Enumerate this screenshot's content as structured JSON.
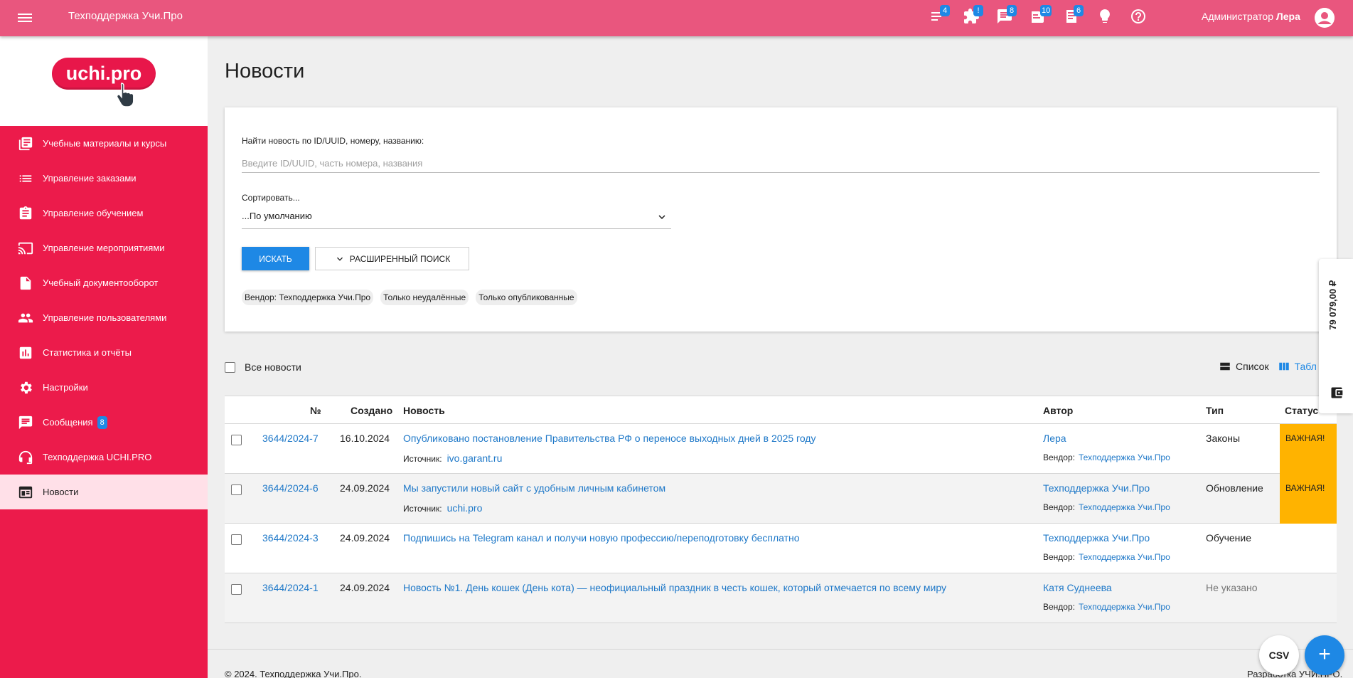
{
  "topbar": {
    "app_title": "Техподдержка Учи.Про",
    "icons": [
      {
        "name": "notifications-list-icon",
        "badge": "4"
      },
      {
        "name": "puzzle-alert-icon",
        "badge": "!"
      },
      {
        "name": "messages-icon",
        "badge": "8"
      },
      {
        "name": "tasks-icon",
        "badge": "10"
      },
      {
        "name": "documents-icon",
        "badge": "6"
      },
      {
        "name": "lightbulb-icon",
        "badge": ""
      },
      {
        "name": "help-icon",
        "badge": ""
      }
    ],
    "user_role": "Администратор",
    "user_name": "Лера"
  },
  "logo": {
    "text": "uchi.pro"
  },
  "sidebar": {
    "items": [
      {
        "label": "Учебные материалы и курсы",
        "icon": "library-books-icon"
      },
      {
        "label": "Управление заказами",
        "icon": "list-icon"
      },
      {
        "label": "Управление обучением",
        "icon": "clipboard-icon"
      },
      {
        "label": "Управление мероприятиями",
        "icon": "cast-icon"
      },
      {
        "label": "Учебный документооборот",
        "icon": "file-icon"
      },
      {
        "label": "Управление пользователями",
        "icon": "people-icon"
      },
      {
        "label": "Статистика и отчёты",
        "icon": "chart-icon"
      },
      {
        "label": "Настройки",
        "icon": "gear-icon"
      },
      {
        "label": "Сообщения",
        "icon": "message-icon",
        "badge": "8"
      },
      {
        "label": "Техподдержка UCHI.PRO",
        "icon": "support-icon"
      },
      {
        "label": "Новости",
        "icon": "news-icon",
        "active": true
      }
    ]
  },
  "main": {
    "title": "Новости",
    "search": {
      "label": "Найти новость по ID/UUID, номеру, названию:",
      "placeholder": "Введите ID/UUID, часть номера, названия",
      "value": ""
    },
    "sort": {
      "label": "Сортировать...",
      "value": "...По умолчанию"
    },
    "search_button": "ИСКАТЬ",
    "advanced_button": "РАСШИРЕННЫЙ ПОИСК",
    "chips": [
      "Вендор: Техподдержка Учи.Про",
      "Только неудалённые",
      "Только опубликованные"
    ],
    "all_news_label": "Все новости",
    "view_list": "Список",
    "view_table": "Табл"
  },
  "table": {
    "headers": {
      "num": "№",
      "created": "Создано",
      "news": "Новость",
      "author": "Автор",
      "type": "Тип",
      "status": "Статус"
    },
    "source_label": "Источник:",
    "vendor_label": "Вендор:",
    "rows": [
      {
        "num": "3644/2024-7",
        "date": "16.10.2024",
        "title": "Опубликовано постановление Правительства РФ о переносе выходных дней в 2025 году",
        "source": "ivo.garant.ru",
        "author": "Лера",
        "vendor": "Техподдержка Учи.Про",
        "type": "Законы",
        "status": "ВАЖНАЯ!"
      },
      {
        "num": "3644/2024-6",
        "date": "24.09.2024",
        "title": "Мы запустили новый сайт с удобным личным кабинетом",
        "source": "uchi.pro",
        "author": "Техподдержка Учи.Про",
        "vendor": "Техподдержка Учи.Про",
        "type": "Обновление",
        "status": "ВАЖНАЯ!"
      },
      {
        "num": "3644/2024-3",
        "date": "24.09.2024",
        "title": "Подпишись на Telegram канал и получи новую профессию/переподготовку бесплатно",
        "source": "",
        "author": "Техподдержка Учи.Про",
        "vendor": "Техподдержка Учи.Про",
        "type": "Обучение",
        "status": ""
      },
      {
        "num": "3644/2024-1",
        "date": "24.09.2024",
        "title": "Новость №1. День кошек (День кота) — неофициальный праздник в честь кошек, который отмечается по всему миру",
        "source": "",
        "author": "Катя Суднеева",
        "vendor": "Техподдержка Учи.Про",
        "type": "Не указано",
        "status": ""
      }
    ]
  },
  "side_panel": {
    "amount": "79 079,00 ₽"
  },
  "fab": {
    "csv": "CSV",
    "add": "+"
  },
  "footer": {
    "left": "©  2024. Техподдержка Учи.Про.",
    "right": "Разработка УЧИ.ПРО."
  },
  "colors": {
    "topbar": "#e9567e",
    "sidebar": "#ec1b4b",
    "accent": "#1e88e5",
    "status_important": "#ffb300"
  }
}
